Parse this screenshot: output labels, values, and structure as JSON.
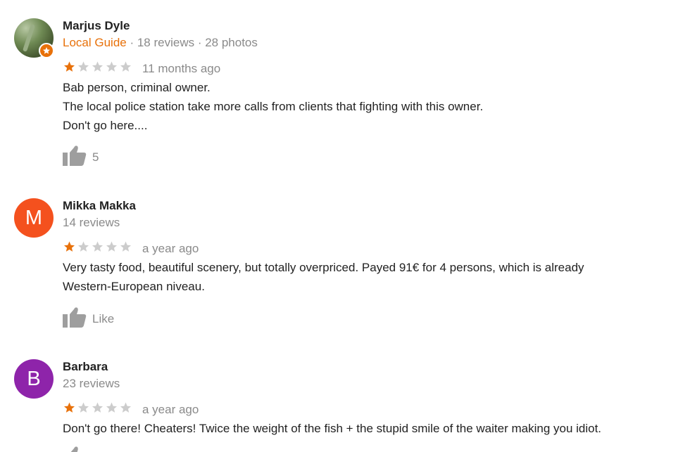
{
  "reviews": [
    {
      "name": "Marjus Dyle",
      "local_guide": "Local Guide",
      "meta_rest": "· 18 reviews · 28 photos",
      "rating": 1,
      "date": "11 months ago",
      "text_lines": [
        "Bab person, criminal owner.",
        "The local police station take more calls from clients that fighting with this owner.",
        "Don't go here...."
      ],
      "like_label": "5",
      "avatar": "photo"
    },
    {
      "name": "Mikka Makka",
      "initial": "M",
      "avatar_color": "#f4511e",
      "meta": "14 reviews",
      "rating": 1,
      "date": "a year ago",
      "text_lines": [
        "Very tasty food, beautiful scenery, but totally overpriced. Payed 91€ for 4 persons, which is already",
        "Western-European niveau."
      ],
      "like_label": "Like"
    },
    {
      "name": "Barbara",
      "initial": "B",
      "avatar_color": "#8e24aa",
      "meta": "23 reviews",
      "rating": 1,
      "date": "a year ago",
      "text_lines": [
        "Don't go there! Cheaters! Twice the weight of the fish + the stupid smile of the waiter making you idiot."
      ]
    }
  ],
  "colors": {
    "star_filled": "#e8710a",
    "star_empty": "#cccccc",
    "guide": "#e8710a",
    "muted_text": "#8a8a8a",
    "thumb": "#9e9e9e"
  },
  "icons": [
    "star-icon",
    "thumbs-up-icon",
    "local-guide-badge-icon"
  ]
}
